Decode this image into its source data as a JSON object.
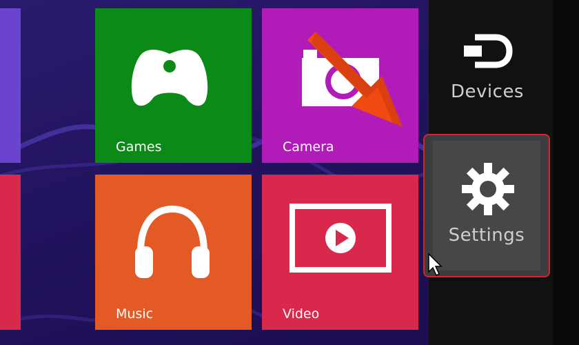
{
  "tiles": {
    "games": {
      "label": "Games",
      "color": "#0b8a17"
    },
    "camera": {
      "label": "Camera",
      "color": "#b11bb8"
    },
    "music": {
      "label": "Music",
      "color": "#e35a25"
    },
    "video": {
      "label": "Video",
      "color": "#d8284b"
    },
    "left_top": {
      "color": "#6a44cf"
    },
    "left_bottom": {
      "color": "#d8284b"
    }
  },
  "charms": {
    "devices": {
      "label": "Devices",
      "icon": "devices-icon"
    },
    "settings": {
      "label": "Settings",
      "icon": "gear-icon"
    }
  },
  "annotation": {
    "arrow_color": "#f04a12",
    "highlight_color": "#d8222d"
  }
}
